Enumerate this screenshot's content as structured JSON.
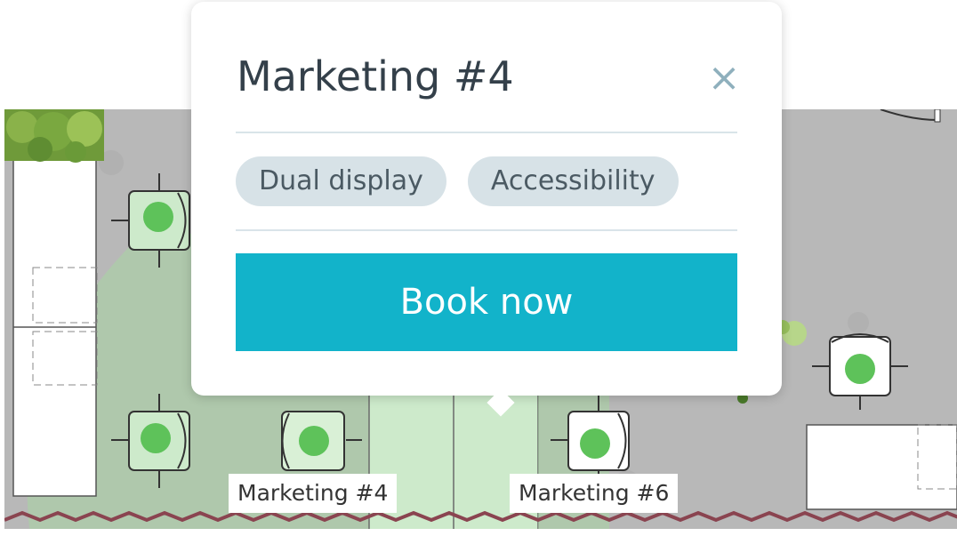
{
  "popup": {
    "title": "Marketing #4",
    "close_symbol": "×",
    "tags": [
      "Dual display",
      "Accessibility"
    ],
    "book_label": "Book now"
  },
  "desks": {
    "labels": [
      "Marketing #4",
      "Marketing #6"
    ]
  },
  "colors": {
    "accent": "#12b3ca",
    "available": "#5ec25a",
    "tag_bg": "#d7e2e7",
    "highlight": "#cdeacb"
  },
  "icons": [
    "close-icon",
    "plant-icon",
    "chair-icon",
    "availability-dot-icon"
  ]
}
